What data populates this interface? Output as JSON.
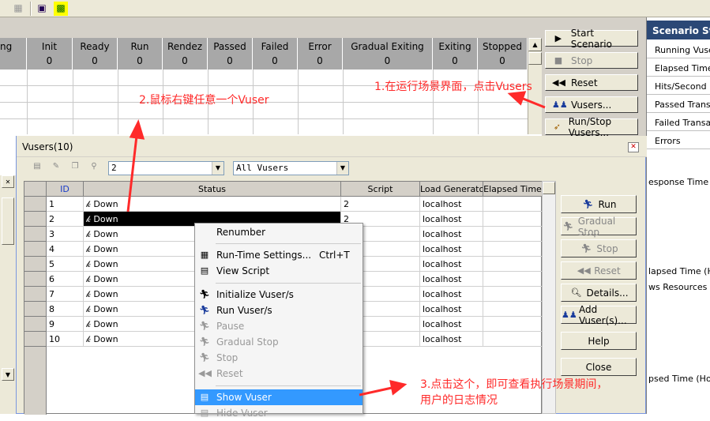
{
  "status_columns": [
    {
      "label": "ng",
      "value": ""
    },
    {
      "label": "Init",
      "value": "0"
    },
    {
      "label": "Ready",
      "value": "0"
    },
    {
      "label": "Run",
      "value": "0"
    },
    {
      "label": "Rendez",
      "value": "0"
    },
    {
      "label": "Passed",
      "value": "0"
    },
    {
      "label": "Failed",
      "value": "0"
    },
    {
      "label": "Error",
      "value": "0"
    },
    {
      "label": "Gradual Exiting",
      "value": "0"
    },
    {
      "label": "Exiting",
      "value": "0"
    },
    {
      "label": "Stopped",
      "value": "0"
    }
  ],
  "controls": {
    "start": "Start Scenario",
    "stop": "Stop",
    "reset": "Reset",
    "vusers": "Vusers...",
    "runstop": "Run/Stop Vusers..."
  },
  "scenario_status": {
    "title": "Scenario Status",
    "rows": [
      "Running Vusers",
      "Elapsed Time",
      "Hits/Second",
      "Passed Transactions",
      "Failed Transactions",
      "Errors"
    ]
  },
  "right_labels": [
    "esponse Time - v",
    "lapsed Time (Hou",
    "ws Resources -",
    "psed Time (Hou"
  ],
  "dialog": {
    "title": "Vusers(10)",
    "group_value": "2",
    "filter_value": "All Vusers",
    "columns": [
      "ID",
      "Status",
      "Script",
      "Load Generator",
      "Elapsed Time"
    ],
    "rows": [
      {
        "id": "1",
        "status": "Down",
        "script": "2",
        "gen": "localhost"
      },
      {
        "id": "2",
        "status": "Down",
        "script": "2",
        "gen": "localhost"
      },
      {
        "id": "3",
        "status": "Down",
        "script": "",
        "gen": "localhost"
      },
      {
        "id": "4",
        "status": "Down",
        "script": "",
        "gen": "localhost"
      },
      {
        "id": "5",
        "status": "Down",
        "script": "",
        "gen": "localhost"
      },
      {
        "id": "6",
        "status": "Down",
        "script": "",
        "gen": "localhost"
      },
      {
        "id": "7",
        "status": "Down",
        "script": "",
        "gen": "localhost"
      },
      {
        "id": "8",
        "status": "Down",
        "script": "",
        "gen": "localhost"
      },
      {
        "id": "9",
        "status": "Down",
        "script": "",
        "gen": "localhost"
      },
      {
        "id": "10",
        "status": "Down",
        "script": "",
        "gen": "localhost"
      }
    ],
    "buttons": {
      "run": "Run",
      "gradual_stop": "Gradual Stop",
      "stop": "Stop",
      "reset": "Reset",
      "details": "Details...",
      "add_vuser": "Add Vuser(s)...",
      "help": "Help",
      "close": "Close"
    }
  },
  "context_menu": {
    "renumber": "Renumber",
    "runtime": "Run-Time Settings...",
    "runtime_shortcut": "Ctrl+T",
    "view_script": "View Script",
    "initialize": "Initialize Vuser/s",
    "run": "Run Vuser/s",
    "pause": "Pause",
    "gradual_stop": "Gradual Stop",
    "stop": "Stop",
    "reset": "Reset",
    "show": "Show Vuser",
    "hide": "Hide Vuser"
  },
  "annotations": {
    "a1": "1.在运行场景界面，点击Vusers",
    "a2": "2.鼠标右键任意一个Vuser",
    "a3_line1": "3.点击这个，即可查看执行场景期间，",
    "a3_line2": "用户的日志情况"
  },
  "colors": {
    "annotation": "#ff2a2a",
    "title_bar": "#2b4876",
    "highlight": "#3399ff"
  }
}
